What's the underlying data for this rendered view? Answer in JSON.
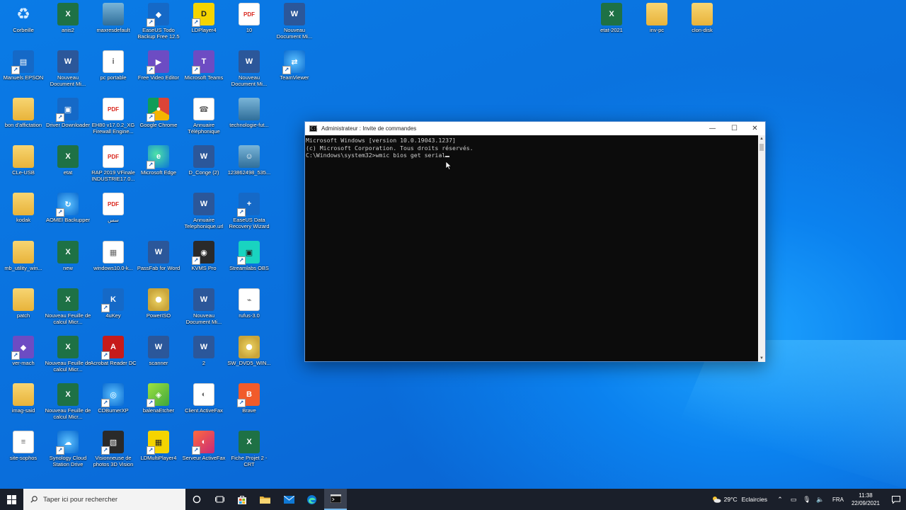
{
  "desktop_icons": [
    {
      "label": "Corbeille",
      "type": "recycle",
      "glyph": "♻"
    },
    {
      "label": "anis2",
      "type": "excel",
      "glyph": "X"
    },
    {
      "label": "maxresdefault",
      "type": "photo",
      "glyph": ""
    },
    {
      "label": "EaseUS Todo Backup Free 12.5",
      "type": "blue",
      "glyph": "◆"
    },
    {
      "label": "LDPlayer4",
      "type": "yellow",
      "glyph": "D"
    },
    {
      "label": "10",
      "type": "pdf",
      "glyph": "PDF"
    },
    {
      "label": "Nouveau Document Mi...",
      "type": "word",
      "glyph": "W"
    },
    {
      "label": "Manuels EPSON",
      "type": "blue",
      "glyph": "▤"
    },
    {
      "label": "Nouveau Document Mi...",
      "type": "word",
      "glyph": "W"
    },
    {
      "label": "pc portable",
      "type": "file",
      "glyph": "i"
    },
    {
      "label": "Free Video Editor",
      "type": "purple",
      "glyph": "▶"
    },
    {
      "label": "Microsoft Teams",
      "type": "purple",
      "glyph": "T"
    },
    {
      "label": "Nouveau Document Mi...",
      "type": "word",
      "glyph": "W"
    },
    {
      "label": "TeamViewer",
      "type": "globe",
      "glyph": "⇄"
    },
    {
      "label": "bon d'affictation",
      "type": "folder",
      "glyph": ""
    },
    {
      "label": "Driver Downloader",
      "type": "blue",
      "glyph": "▣"
    },
    {
      "label": "EH80 v17.0.2_XG Firewall Engine...",
      "type": "pdf",
      "glyph": "PDF"
    },
    {
      "label": "Google Chrome",
      "type": "chrome",
      "glyph": "●"
    },
    {
      "label": "Annuaire Téléphonique",
      "type": "file",
      "glyph": "☎"
    },
    {
      "label": "technologie-fut...",
      "type": "photo",
      "glyph": ""
    },
    {
      "label": "CLe-USB",
      "type": "folder",
      "glyph": ""
    },
    {
      "label": "etat",
      "type": "excel",
      "glyph": "X"
    },
    {
      "label": "RAP 2019 VFinale INDUSTRIE17.0...",
      "type": "pdf",
      "glyph": "PDF"
    },
    {
      "label": "Microsoft Edge",
      "type": "edge",
      "glyph": "e"
    },
    {
      "label": "D_Conge (2)",
      "type": "word",
      "glyph": "W"
    },
    {
      "label": "123862498_535...",
      "type": "photo",
      "glyph": "☺"
    },
    {
      "label": "kodak",
      "type": "folder",
      "glyph": ""
    },
    {
      "label": "AOMEI Backupper",
      "type": "globe",
      "glyph": "↻"
    },
    {
      "label": "سس",
      "type": "pdf",
      "glyph": "PDF"
    },
    {
      "label": "Annuaire Telephonique.url",
      "type": "word",
      "glyph": "W"
    },
    {
      "label": "EaseUS Data Recovery Wizard",
      "type": "blue",
      "glyph": "+"
    },
    {
      "label": "mb_utility_win...",
      "type": "folder",
      "glyph": ""
    },
    {
      "label": "new",
      "type": "excel",
      "glyph": "X"
    },
    {
      "label": "windows10.0-k...",
      "type": "file",
      "glyph": "▦"
    },
    {
      "label": "PassFab for Word",
      "type": "word",
      "glyph": "W"
    },
    {
      "label": "KVMS Pro",
      "type": "dark",
      "glyph": "◉"
    },
    {
      "label": "Streamlabs OBS",
      "type": "teal",
      "glyph": "▣"
    },
    {
      "label": "patch",
      "type": "folder",
      "glyph": ""
    },
    {
      "label": "Nouveau Feuille de calcul Micr...",
      "type": "excel",
      "glyph": "X"
    },
    {
      "label": "4uKey",
      "type": "blue",
      "glyph": "K"
    },
    {
      "label": "PowerISO",
      "type": "disc",
      "glyph": ""
    },
    {
      "label": "Nouveau Document Mi...",
      "type": "word",
      "glyph": "W"
    },
    {
      "label": "rufus-3.0",
      "type": "file",
      "glyph": "⌁"
    },
    {
      "label": "ver-mach",
      "type": "purple",
      "glyph": "◆"
    },
    {
      "label": "Nouveau Feuille de calcul Micr...",
      "type": "excel",
      "glyph": "X"
    },
    {
      "label": "Acrobat Reader DC",
      "type": "red",
      "glyph": "A"
    },
    {
      "label": "scanner",
      "type": "word",
      "glyph": "W"
    },
    {
      "label": "2",
      "type": "word",
      "glyph": "W"
    },
    {
      "label": "SW_DVD5_WIN...",
      "type": "disc",
      "glyph": ""
    },
    {
      "label": "imag-said",
      "type": "folder",
      "glyph": ""
    },
    {
      "label": "Nouveau Feuille de calcul Micr...",
      "type": "excel",
      "glyph": "X"
    },
    {
      "label": "CDBurnerXP",
      "type": "globe",
      "glyph": "◎"
    },
    {
      "label": "balenaEtcher",
      "type": "green3",
      "glyph": "◈"
    },
    {
      "label": "Client ActiveFax",
      "type": "file",
      "glyph": "◐"
    },
    {
      "label": "Brave",
      "type": "brave",
      "glyph": "B"
    },
    {
      "label": "site-sophos",
      "type": "file",
      "glyph": "≡"
    },
    {
      "label": "Synology Cloud Station Drive",
      "type": "globe",
      "glyph": "☁"
    },
    {
      "label": "Visionneuse de photos 3D Vision",
      "type": "dark",
      "glyph": "▧"
    },
    {
      "label": "LDMultiPlayer4",
      "type": "yellow",
      "glyph": "▦"
    },
    {
      "label": "Serveur ActiveFax",
      "type": "orange",
      "glyph": "◐"
    },
    {
      "label": "Fiche Projet 2 -CRT",
      "type": "excel",
      "glyph": "X"
    },
    {
      "label": "etat-2021",
      "type": "excel",
      "glyph": "X"
    },
    {
      "label": "inv-pc",
      "type": "folder",
      "glyph": ""
    },
    {
      "label": "clon-disk",
      "type": "folder",
      "glyph": ""
    }
  ],
  "cmd": {
    "title": "Administrateur : Invite de commandes",
    "line1": "Microsoft Windows [version 10.0.19043.1237]",
    "line2": "(c) Microsoft Corporation. Tous droits réservés.",
    "line3": "",
    "prompt": "C:\\Windows\\system32>wmic bios get serial",
    "min_glyph": "—",
    "max_glyph": "☐",
    "close_glyph": "✕"
  },
  "taskbar": {
    "search_placeholder": "Taper ici pour rechercher",
    "weather_temp": "29°C",
    "weather_desc": "Eclaircies",
    "language": "FRA",
    "time": "11:38",
    "date": "22/09/2021"
  },
  "colors": {
    "desktop": "#0a70dc",
    "taskbar": "#1a1f2a",
    "cmd_bg": "#0c0c0c",
    "cmd_text": "#cccccc"
  }
}
